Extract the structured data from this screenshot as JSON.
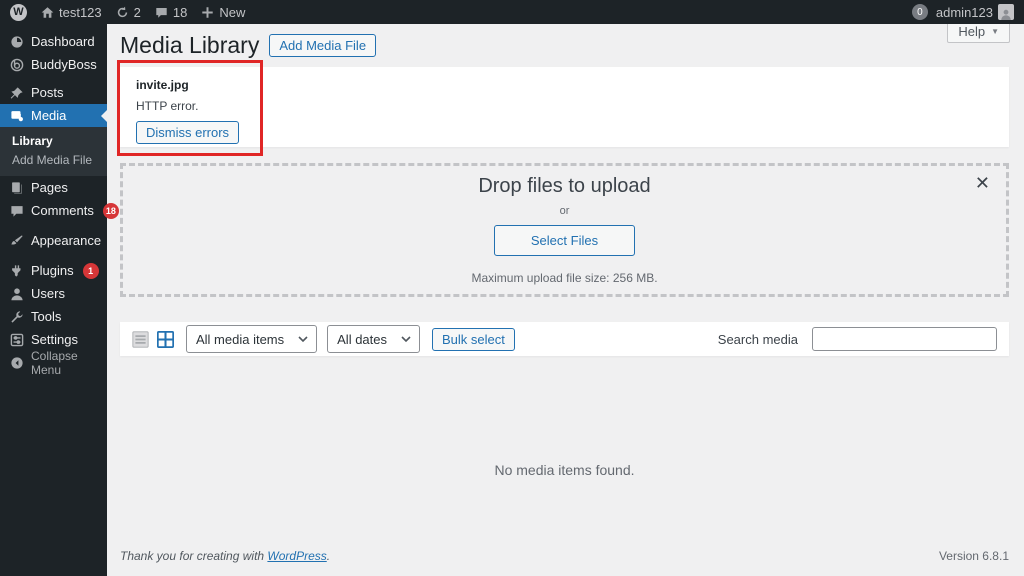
{
  "admin_bar": {
    "site_name": "test123",
    "updates_count": "2",
    "comments_count": "18",
    "new_label": "New",
    "notifications_count": "0",
    "username": "admin123"
  },
  "sidebar": {
    "items": [
      {
        "label": "Dashboard"
      },
      {
        "label": "BuddyBoss"
      },
      {
        "label": "Posts"
      },
      {
        "label": "Media"
      },
      {
        "label": "Pages"
      },
      {
        "label": "Comments",
        "badge": "18"
      },
      {
        "label": "Appearance"
      },
      {
        "label": "Plugins",
        "badge": "1"
      },
      {
        "label": "Users"
      },
      {
        "label": "Tools"
      },
      {
        "label": "Settings"
      },
      {
        "label": "Collapse Menu"
      }
    ],
    "media_submenu": [
      {
        "label": "Library"
      },
      {
        "label": "Add Media File"
      }
    ]
  },
  "header": {
    "title": "Media Library",
    "add_button": "Add Media File",
    "help_label": "Help",
    "help_caret": "▼"
  },
  "upload_error": {
    "filename": "invite.jpg",
    "message": "HTTP error.",
    "dismiss_label": "Dismiss errors"
  },
  "dropzone": {
    "title": "Drop files to upload",
    "or_label": "or",
    "select_button": "Select Files",
    "max_size_note": "Maximum upload file size: 256 MB.",
    "close_glyph": "✕"
  },
  "toolbar": {
    "media_filter": "All media items",
    "date_filter": "All dates",
    "bulk_select_label": "Bulk select",
    "search_label": "Search media",
    "search_value": ""
  },
  "main": {
    "empty_message": "No media items found."
  },
  "footer": {
    "thanks_prefix": "Thank you for creating with ",
    "wordpress_link": "WordPress",
    "thanks_suffix": ".",
    "version": "Version 6.8.1"
  },
  "colors": {
    "accent_blue": "#2271b1",
    "badge_red": "#d63638",
    "annotation_red": "#e02626",
    "admin_dark": "#1d2327",
    "submenu_dark": "#2c3338",
    "content_bg": "#f0f0f1"
  }
}
